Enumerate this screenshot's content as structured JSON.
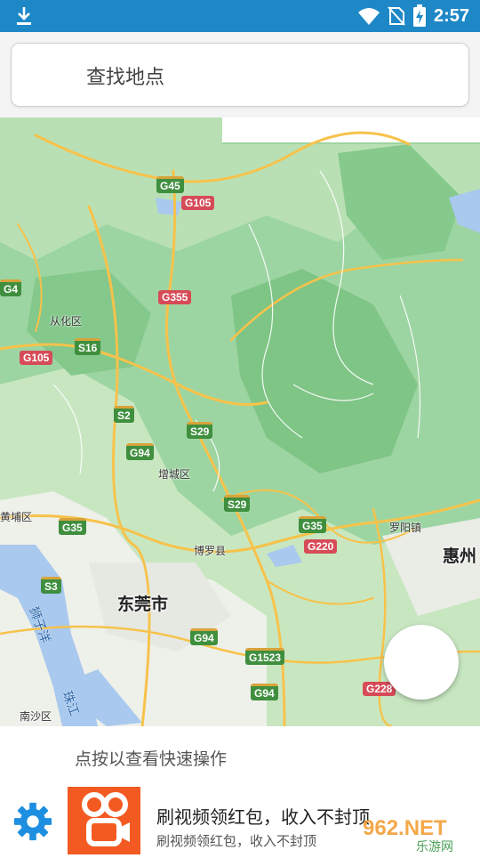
{
  "status_bar": {
    "time": "2:57",
    "icons": [
      "download-icon",
      "wifi-icon",
      "no-sim-icon",
      "battery-charging-icon"
    ]
  },
  "search": {
    "placeholder": "查找地点"
  },
  "map": {
    "shields": [
      {
        "label": "G45",
        "type": "national-expressway"
      },
      {
        "label": "G105",
        "type": "national-road"
      },
      {
        "label": "G4",
        "type": "national-expressway"
      },
      {
        "label": "G355",
        "type": "national-road"
      },
      {
        "label": "S16",
        "type": "provincial-expressway"
      },
      {
        "label": "G105",
        "type": "national-road"
      },
      {
        "label": "S2",
        "type": "provincial-expressway"
      },
      {
        "label": "S29",
        "type": "provincial-expressway"
      },
      {
        "label": "G94",
        "type": "national-expressway"
      },
      {
        "label": "S29",
        "type": "provincial-expressway"
      },
      {
        "label": "G35",
        "type": "national-expressway"
      },
      {
        "label": "G35",
        "type": "national-expressway"
      },
      {
        "label": "G220",
        "type": "national-road"
      },
      {
        "label": "S3",
        "type": "provincial-expressway"
      },
      {
        "label": "G94",
        "type": "national-expressway"
      },
      {
        "label": "G1523",
        "type": "national-expressway"
      },
      {
        "label": "G94",
        "type": "national-expressway"
      },
      {
        "label": "G228",
        "type": "national-road"
      }
    ],
    "places": [
      "从化区",
      "增城区",
      "黄埔区",
      "博罗县",
      "罗阳镇",
      "南沙区"
    ],
    "cities": [
      "东莞市",
      "惠州"
    ],
    "rivers": [
      "狮子洋",
      "珠江"
    ],
    "colors": {
      "land": "#8ccf93",
      "land_light": "#c6e6c0",
      "urban": "#f1f1ee",
      "water": "#a9c9ee",
      "road": "#f7c24a"
    }
  },
  "hint": "点按以查看快速操作",
  "ad": {
    "title": "刷视频领红包，收入不封顶",
    "subtitle": "刷视频领红包，收入不封顶",
    "brand_color": "#f25a22",
    "watermark": "962.NET",
    "watermark_sub": "乐游网"
  }
}
